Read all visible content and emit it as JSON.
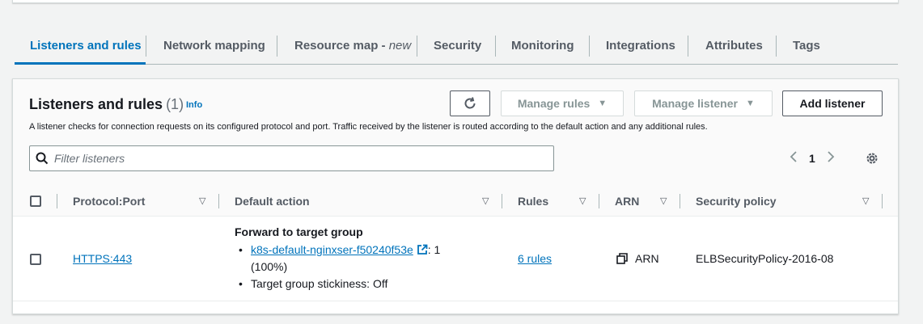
{
  "tabs": [
    {
      "label": "Listeners and rules",
      "active": true
    },
    {
      "label": "Network mapping"
    },
    {
      "label": "Resource map - ",
      "tag": "new"
    },
    {
      "label": "Security"
    },
    {
      "label": "Monitoring"
    },
    {
      "label": "Integrations"
    },
    {
      "label": "Attributes"
    },
    {
      "label": "Tags"
    }
  ],
  "panel": {
    "title": "Listeners and rules",
    "count": "(1)",
    "info": "Info",
    "description": "A listener checks for connection requests on its configured protocol and port. Traffic received by the listener is routed according to the default action and any additional rules.",
    "manage_rules": "Manage rules",
    "manage_listener": "Manage listener",
    "add_listener": "Add listener",
    "filter_placeholder": "Filter listeners",
    "page": "1"
  },
  "table": {
    "columns": [
      "Protocol:Port",
      "Default action",
      "Rules",
      "ARN",
      "Security policy"
    ],
    "rows": [
      {
        "protocol_port": "HTTPS:443",
        "action_title": "Forward to target group",
        "target_group": "k8s-default-nginxser-f50240f53e",
        "weight_suffix": ": 1",
        "weight_pct": "(100%)",
        "stickiness": "Target group stickiness: Off",
        "rules": "6 rules",
        "arn": "ARN",
        "security_policy": "ELBSecurityPolicy-2016-08"
      }
    ]
  },
  "colors": {
    "accent": "#0073bb",
    "text": "#16191f",
    "muted": "#545b64"
  }
}
